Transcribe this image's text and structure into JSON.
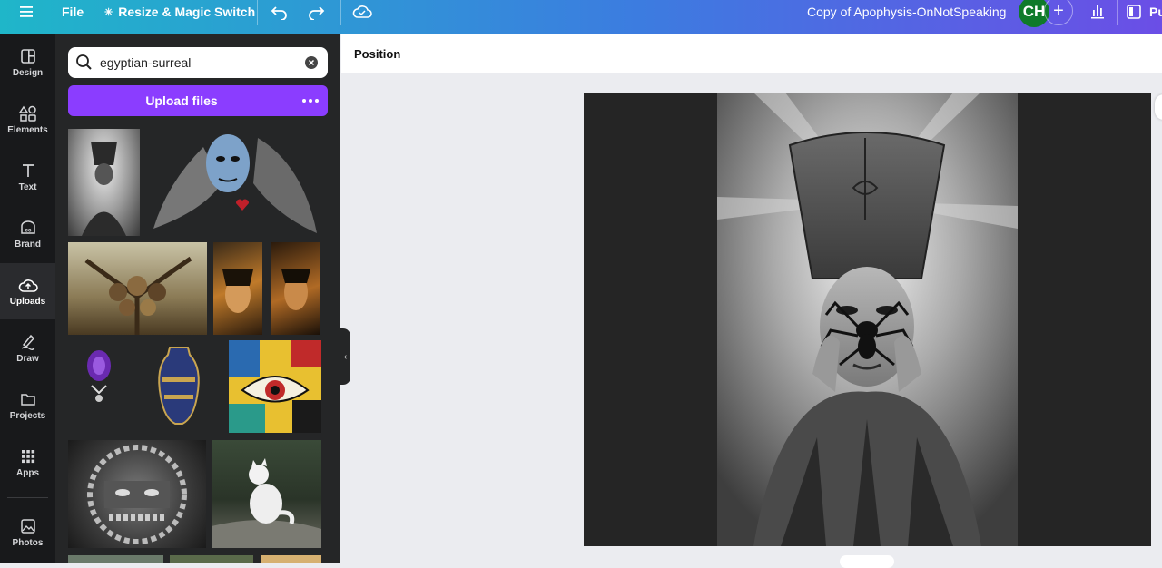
{
  "topbar": {
    "menu_icon": "hamburger-menu-icon",
    "file_label": "File",
    "resize_label": "Resize & Magic Switch",
    "document_title": "Copy of Apophysis-OnNotSpeaking",
    "avatar_initials": "CH",
    "publish_label": "Pu"
  },
  "rail": {
    "items": [
      {
        "label": "Design",
        "icon": "design-icon"
      },
      {
        "label": "Elements",
        "icon": "elements-icon"
      },
      {
        "label": "Text",
        "icon": "text-icon"
      },
      {
        "label": "Brand",
        "icon": "brand-icon"
      },
      {
        "label": "Uploads",
        "icon": "uploads-icon",
        "active": true
      },
      {
        "label": "Draw",
        "icon": "draw-icon"
      },
      {
        "label": "Projects",
        "icon": "projects-icon"
      },
      {
        "label": "Apps",
        "icon": "apps-icon"
      },
      {
        "label": "Photos",
        "icon": "photos-icon"
      }
    ]
  },
  "panel": {
    "search_value": "egyptian-surreal",
    "upload_label": "Upload files"
  },
  "options_bar": {
    "position_label": "Position"
  },
  "colors": {
    "accent": "#8b3dff",
    "rail_bg": "#18191b",
    "panel_bg": "#252627",
    "canvas_bg": "#ebecf0",
    "avatar": "#0f7a2a"
  }
}
